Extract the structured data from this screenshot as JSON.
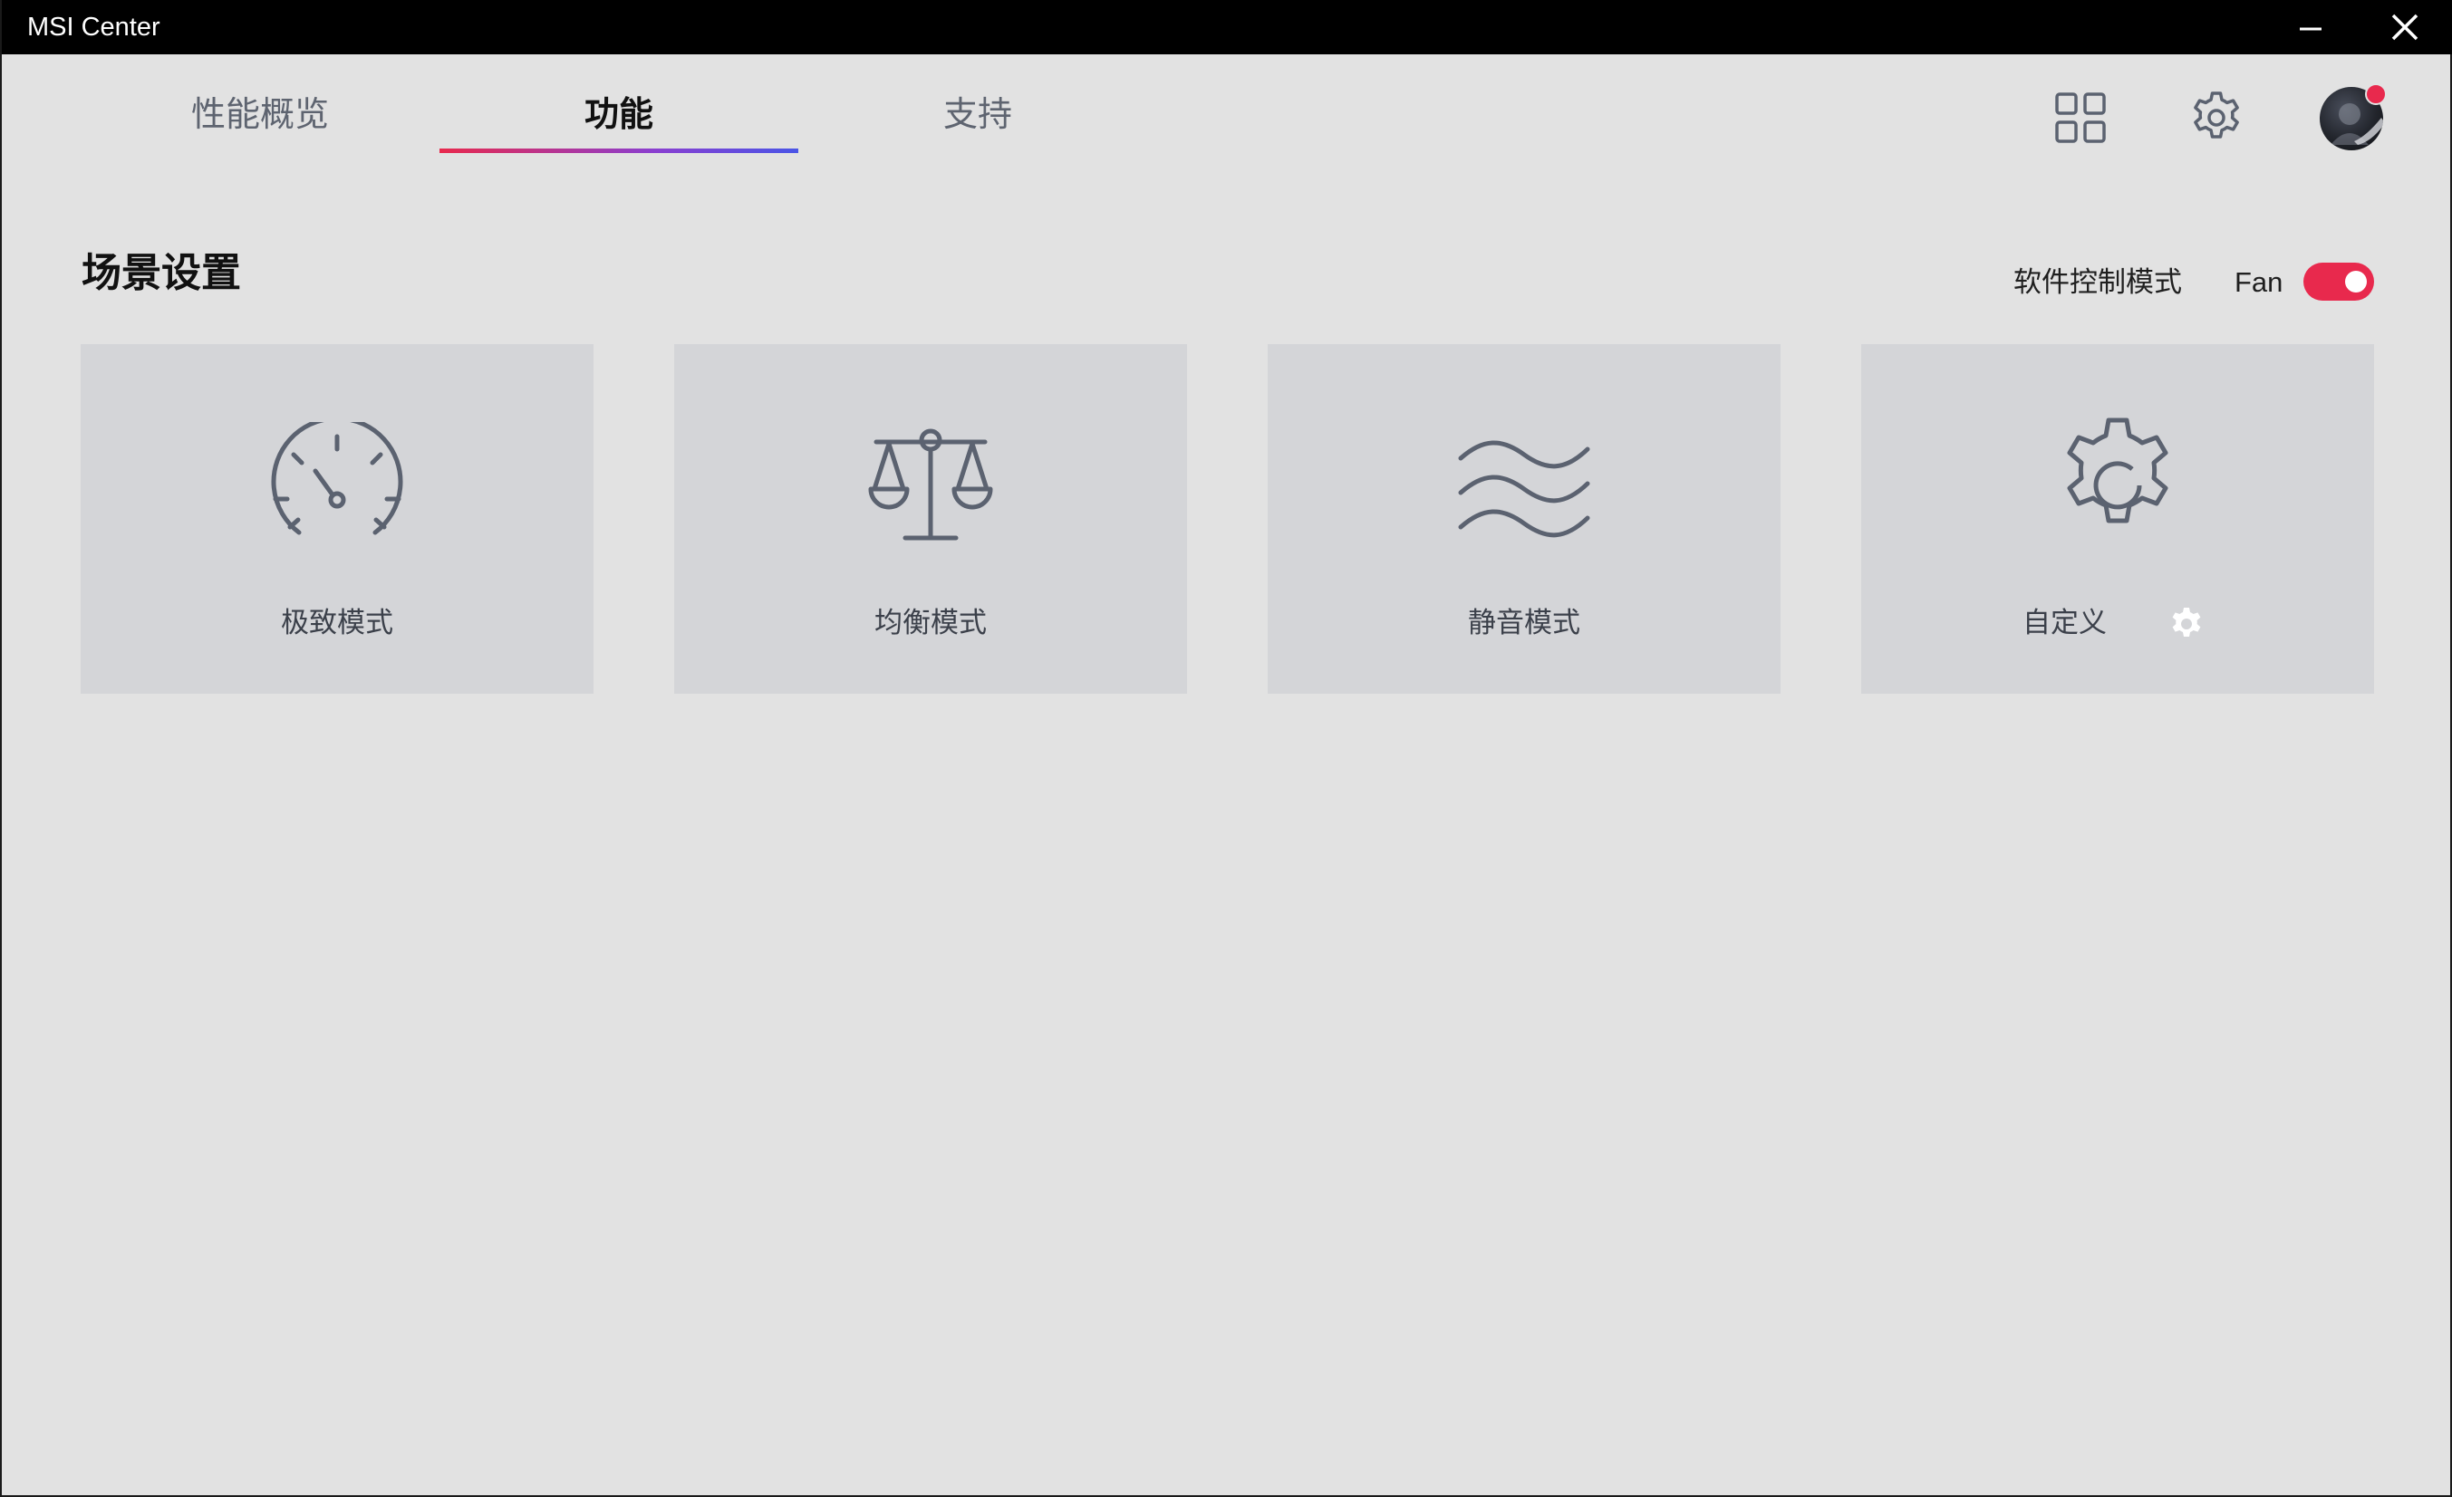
{
  "window": {
    "title": "MSI Center"
  },
  "tabs": [
    {
      "label": "性能概览",
      "active": false
    },
    {
      "label": "功能",
      "active": true
    },
    {
      "label": "支持",
      "active": false
    }
  ],
  "header_icons": {
    "apps": "grid-icon",
    "settings": "gear-icon",
    "avatar": "avatar",
    "notification_color": "#e8294d"
  },
  "scene": {
    "title": "场景设置",
    "software_control_label": "软件控制模式",
    "fan_label": "Fan",
    "fan_toggle_on": true,
    "toggle_color": "#e8294d"
  },
  "modes": [
    {
      "label": "极致模式",
      "icon": "speedometer-icon"
    },
    {
      "label": "均衡模式",
      "icon": "balance-scale-icon"
    },
    {
      "label": "静音模式",
      "icon": "waves-icon"
    },
    {
      "label": "自定义",
      "icon": "gear-icon"
    }
  ],
  "colors": {
    "background": "#e2e2e2",
    "card": "#d4d5d8",
    "icon_stroke": "#5b6270",
    "accent": "#e8294d"
  }
}
